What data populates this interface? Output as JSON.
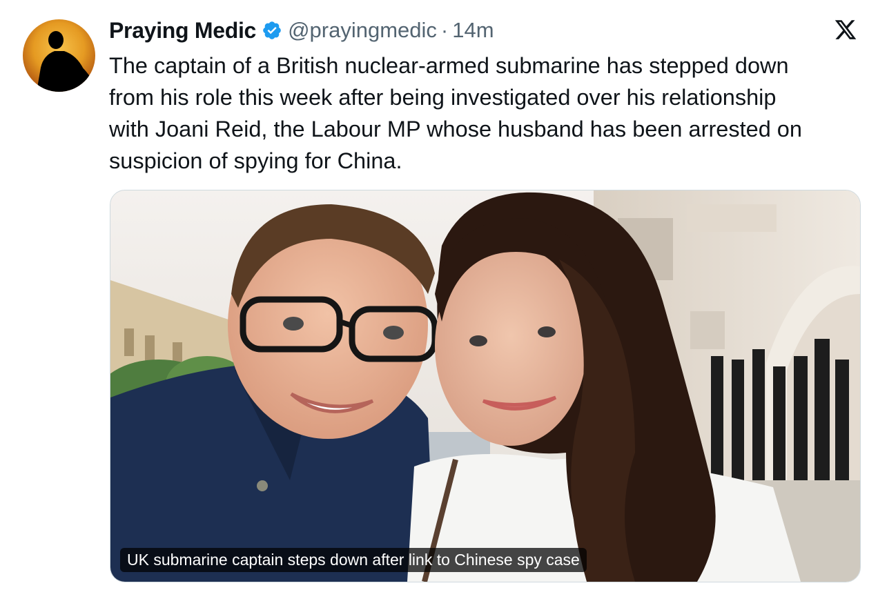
{
  "author": {
    "name": "Praying Medic",
    "handle": "@prayingmedic",
    "separator": "·",
    "time": "14m",
    "verified": true,
    "avatar_icon": "silhouette-avatar"
  },
  "platform_icon": "x-logo-icon",
  "tweet": {
    "lines": [
      "The captain of a British nuclear-armed submarine has stepped down",
      "from his role this week after being investigated over his relationship",
      "with Joani Reid, the Labour MP whose husband has been arrested on",
      "suspicion of spying for China."
    ]
  },
  "media": {
    "caption": "UK submarine captain steps down after link to Chinese spy case"
  },
  "colors": {
    "verified_blue": "#1d9bf0",
    "text_primary": "#0f1419",
    "text_secondary": "#536471"
  }
}
